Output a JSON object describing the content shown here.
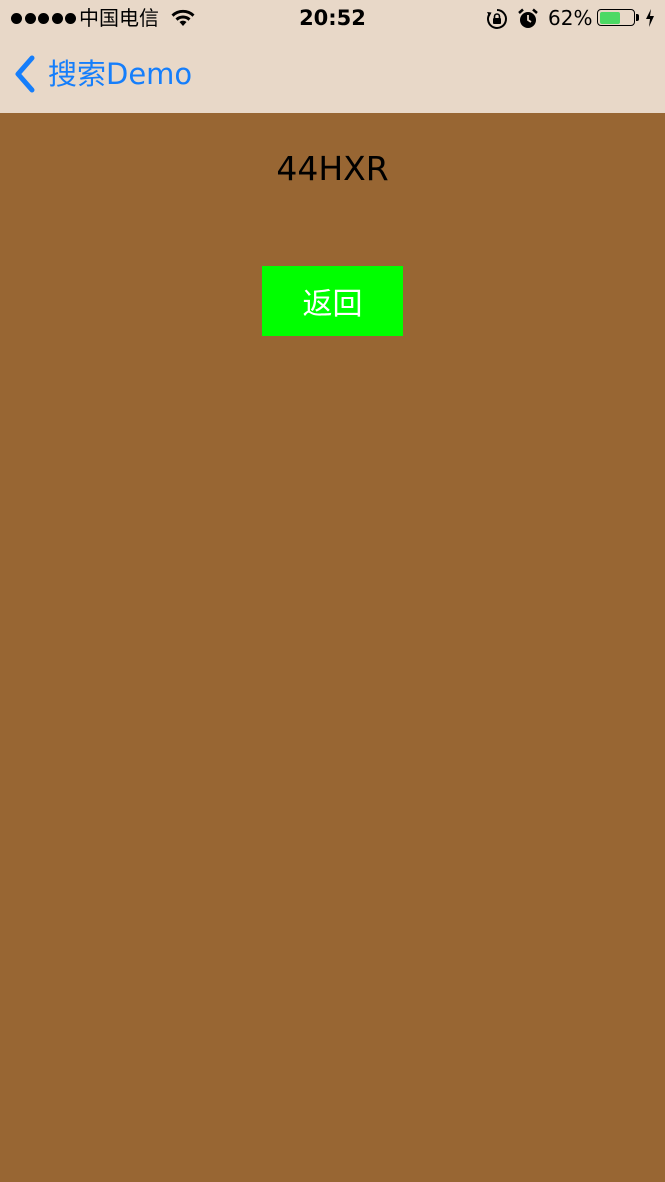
{
  "status_bar": {
    "carrier": "中国电信",
    "time": "20:52",
    "battery_percent": "62%",
    "battery_level": 0.62,
    "signal_bars": 5,
    "icons": [
      "wifi-icon",
      "orientation-lock-icon",
      "alarm-icon",
      "battery-icon",
      "charging-bolt-icon"
    ]
  },
  "nav": {
    "back_label": "搜索Demo",
    "back_icon": "chevron-left-icon"
  },
  "main": {
    "code_text": "44HXR",
    "return_button_label": "返回"
  },
  "colors": {
    "nav_background": "#e8d8c8",
    "page_background": "#986633",
    "accent_blue": "#157efb",
    "button_green": "#00ff00"
  }
}
